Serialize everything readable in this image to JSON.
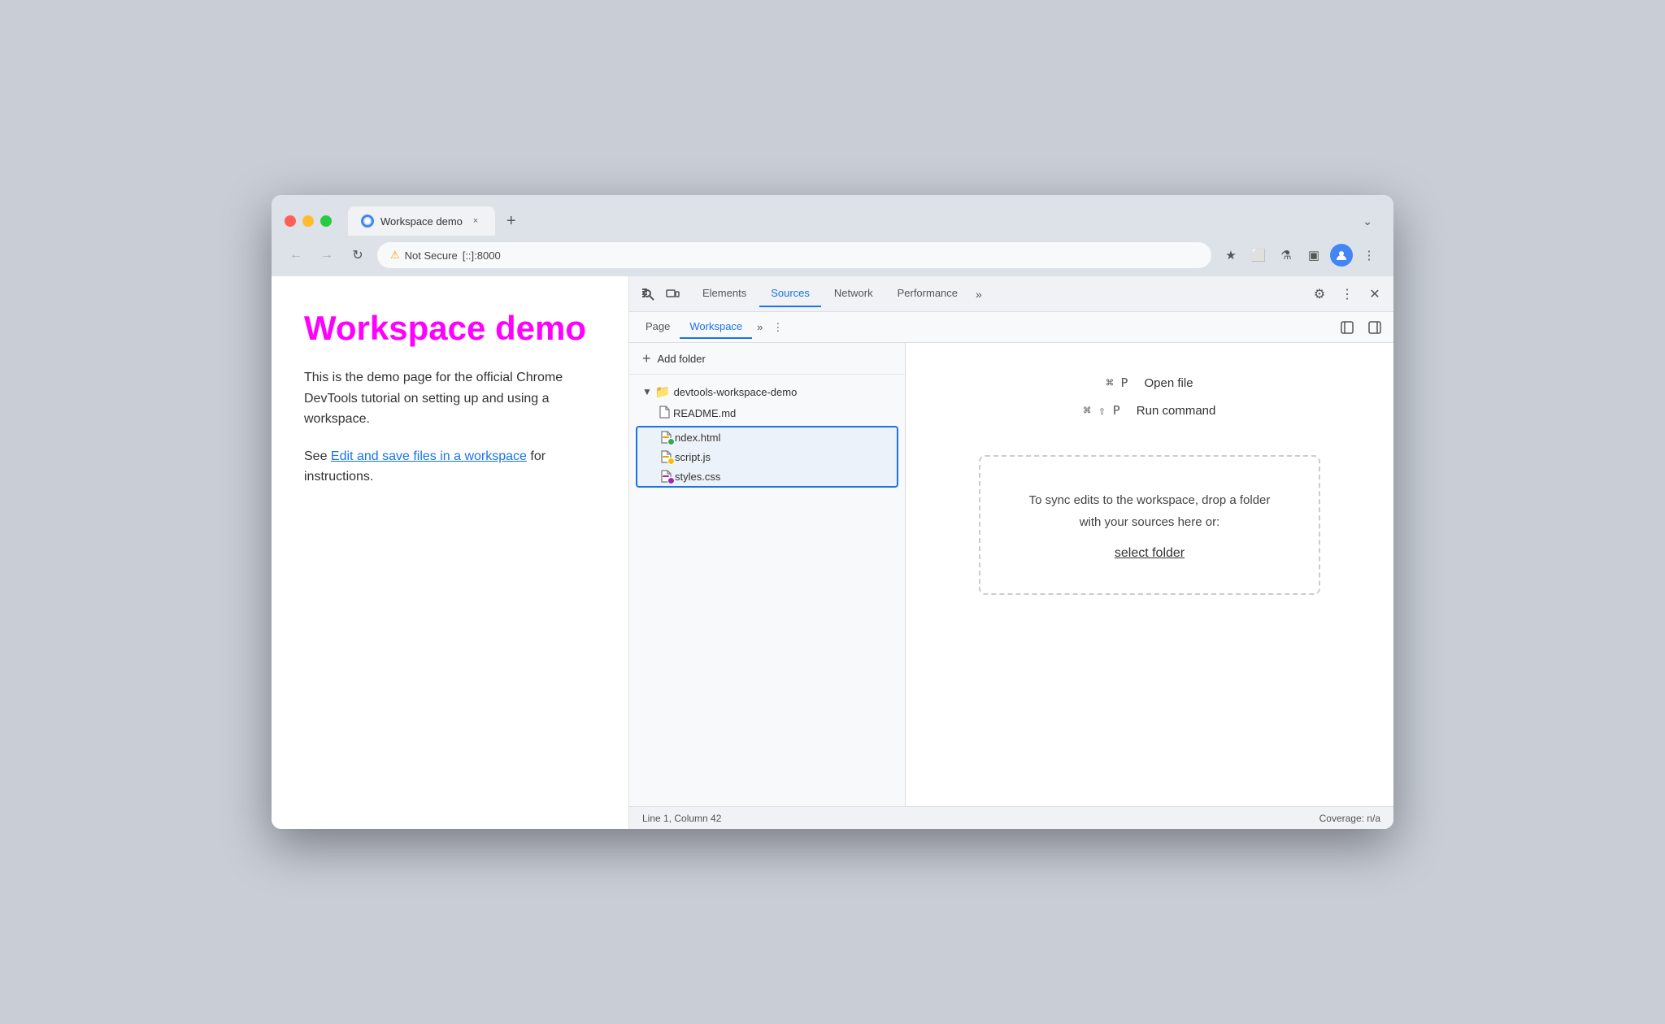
{
  "browser": {
    "tab": {
      "favicon_text": "◉",
      "title": "Workspace demo",
      "close_label": "×",
      "new_tab_label": "+",
      "overflow_label": "⌄"
    },
    "nav": {
      "back_label": "←",
      "forward_label": "→",
      "refresh_label": "↻",
      "not_secure_label": "Not Secure",
      "url": "[::]​:8000",
      "bookmark_label": "★",
      "extensions_label": "⬜",
      "labs_label": "⚗",
      "sidebar_label": "▣",
      "user_label": "👤",
      "more_label": "⋮"
    }
  },
  "webpage": {
    "title": "Workspace demo",
    "description": "This is the demo page for the official Chrome DevTools tutorial on setting up and using a workspace.",
    "see_label": "See ",
    "link_text": "Edit and save files in a workspace",
    "instructions_label": " for instructions."
  },
  "devtools": {
    "toolbar": {
      "inspect_label": "⠿",
      "device_label": "⬜",
      "tabs": [
        "Elements",
        "Sources",
        "Network",
        "Performance"
      ],
      "active_tab": "Sources",
      "overflow_label": "»",
      "settings_label": "⚙",
      "more_label": "⋮",
      "close_label": "✕"
    },
    "secondary_toolbar": {
      "tabs": [
        "Page",
        "Workspace"
      ],
      "active_tab": "Workspace",
      "overflow_label": "»",
      "more_label": "⋮",
      "collapse_left_label": "◁",
      "collapse_right_label": "▷"
    },
    "file_panel": {
      "add_folder_label": "+ Add folder",
      "folder_name": "devtools-workspace-demo",
      "files": [
        {
          "name": "README.md",
          "dot": null,
          "type": "plain"
        },
        {
          "name": "ndex.html",
          "dot": "green",
          "type": "html"
        },
        {
          "name": "script.js",
          "dot": "orange",
          "type": "js"
        },
        {
          "name": "styles.css",
          "dot": "purple",
          "type": "css"
        }
      ]
    },
    "editor": {
      "shortcut1": {
        "keys": "⌘ P",
        "action": "Open file"
      },
      "shortcut2": {
        "keys": "⌘ ⇧ P",
        "action": "Run command"
      },
      "drop_area": {
        "text": "To sync edits to the workspace, drop a folder with your sources here or:",
        "select_folder_label": "select folder"
      }
    },
    "status_bar": {
      "position": "Line 1, Column 42",
      "coverage": "Coverage: n/a"
    }
  }
}
